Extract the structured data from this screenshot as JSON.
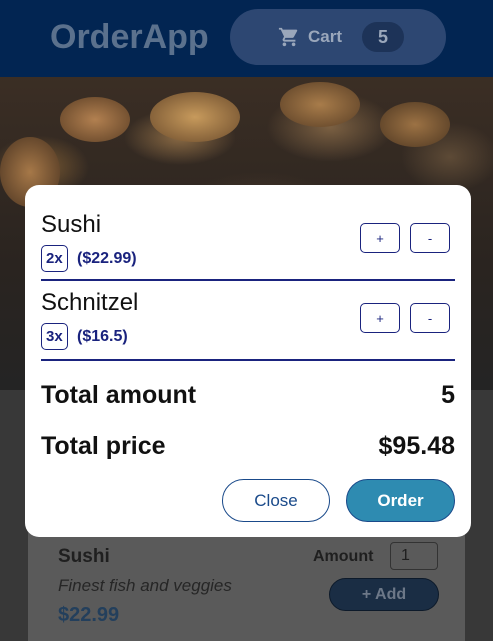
{
  "header": {
    "app_title": "OrderApp",
    "cart_label": "Cart",
    "cart_count": "5"
  },
  "modal": {
    "items": [
      {
        "name": "Sushi",
        "quantity": "2x",
        "price": "($22.99)",
        "increase": "+",
        "decrease": "-"
      },
      {
        "name": "Schnitzel",
        "quantity": "3x",
        "price": "($16.5)",
        "increase": "+",
        "decrease": "-"
      }
    ],
    "total_amount_label": "Total amount",
    "total_amount_value": "5",
    "total_price_label": "Total price",
    "total_price_value": "$95.48",
    "close_label": "Close",
    "order_label": "Order"
  },
  "meal": {
    "name": "Sushi",
    "description": "Finest fish and veggies",
    "price": "$22.99",
    "amount_label": "Amount",
    "amount_value": "1",
    "add_label": "+ Add"
  },
  "icons": {
    "cart": "cart-icon"
  },
  "colors": {
    "header_bg": "#022552",
    "accent_blue": "#1a237e",
    "order_button": "#2e8bb1"
  }
}
